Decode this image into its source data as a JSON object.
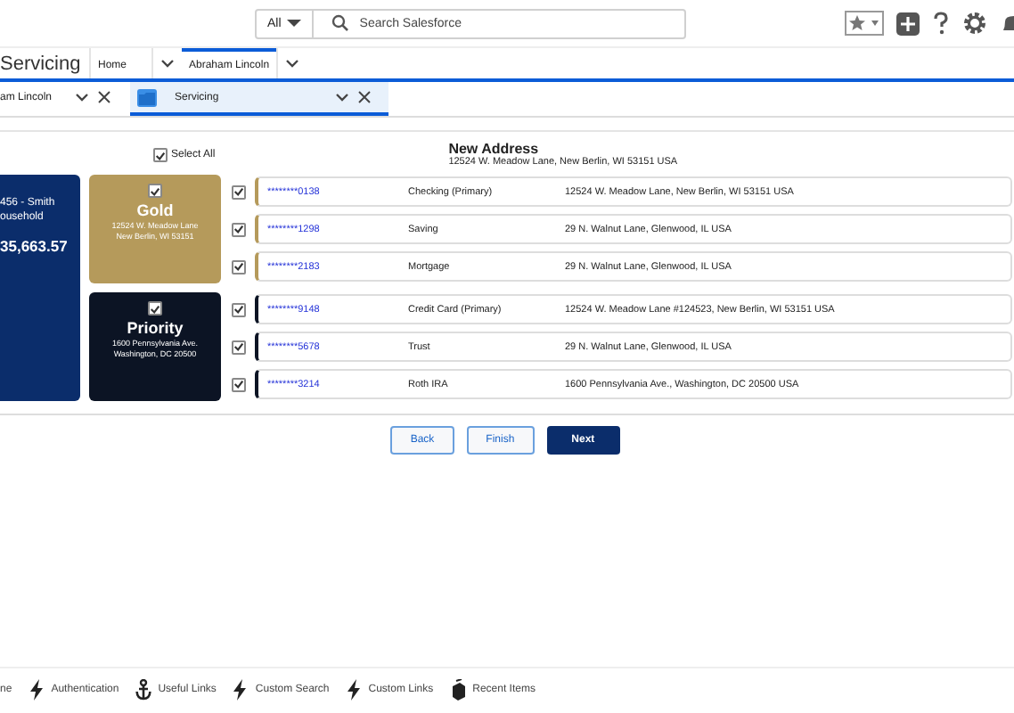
{
  "header": {
    "search_scope": "All",
    "search_placeholder": "Search Salesforce"
  },
  "nav": {
    "app_name": "Servicing",
    "tabs": [
      {
        "label": "Home",
        "selected": false
      },
      {
        "label": "Abraham Lincoln",
        "selected": true
      }
    ]
  },
  "subtabs": [
    {
      "label": "am Lincoln",
      "selected": false,
      "kind": "record"
    },
    {
      "label": "Servicing",
      "selected": true,
      "kind": "folder"
    }
  ],
  "select_all": {
    "label": "Select All",
    "checked": true
  },
  "new_address": {
    "title": "New Address",
    "value": "12524 W. Meadow Lane, New Berlin, WI 53151 USA"
  },
  "household": {
    "name_lines": [
      "456 - Smith",
      "ousehold"
    ],
    "amount": "35,663.57"
  },
  "groups": [
    {
      "title": "Gold",
      "address_lines": [
        "12524 W. Meadow Lane",
        "New Berlin, WI 53151"
      ],
      "checked": true,
      "color": "#b59a5b",
      "accounts": [
        {
          "number": "********0138",
          "type": "Checking (Primary)",
          "address": "12524 W. Meadow Lane, New Berlin, WI 53151 USA",
          "checked": true
        },
        {
          "number": "********1298",
          "type": "Saving",
          "address": "29 N. Walnut Lane, Glenwood, IL USA",
          "checked": true
        },
        {
          "number": "********2183",
          "type": "Mortgage",
          "address": "29 N. Walnut Lane, Glenwood, IL USA",
          "checked": true
        }
      ]
    },
    {
      "title": "Priority",
      "address_lines": [
        "1600 Pennsylvania Ave.",
        "Washington, DC 20500"
      ],
      "checked": true,
      "color": "#0c1424",
      "accounts": [
        {
          "number": "********9148",
          "type": "Credit Card (Primary)",
          "address": "12524 W. Meadow Lane #124523, New Berlin, WI 53151 USA",
          "checked": true
        },
        {
          "number": "********5678",
          "type": "Trust",
          "address": "29 N. Walnut Lane, Glenwood, IL USA",
          "checked": true
        },
        {
          "number": "********3214",
          "type": "Roth IRA",
          "address": "1600 Pennsylvania Ave., Washington, DC 20500 USA",
          "checked": true
        }
      ]
    }
  ],
  "buttons": [
    {
      "label": "Back",
      "kind": "neutral"
    },
    {
      "label": "Finish",
      "kind": "neutral"
    },
    {
      "label": "Next",
      "kind": "brand"
    }
  ],
  "utility_bar": [
    {
      "label": "ne",
      "kind": "plain"
    },
    {
      "label": "Authentication",
      "kind": "action"
    },
    {
      "label": "Useful Links",
      "kind": "links"
    },
    {
      "label": "Custom Search",
      "kind": "action"
    },
    {
      "label": "Custom Links",
      "kind": "action"
    },
    {
      "label": "Recent Items",
      "kind": "history"
    }
  ]
}
